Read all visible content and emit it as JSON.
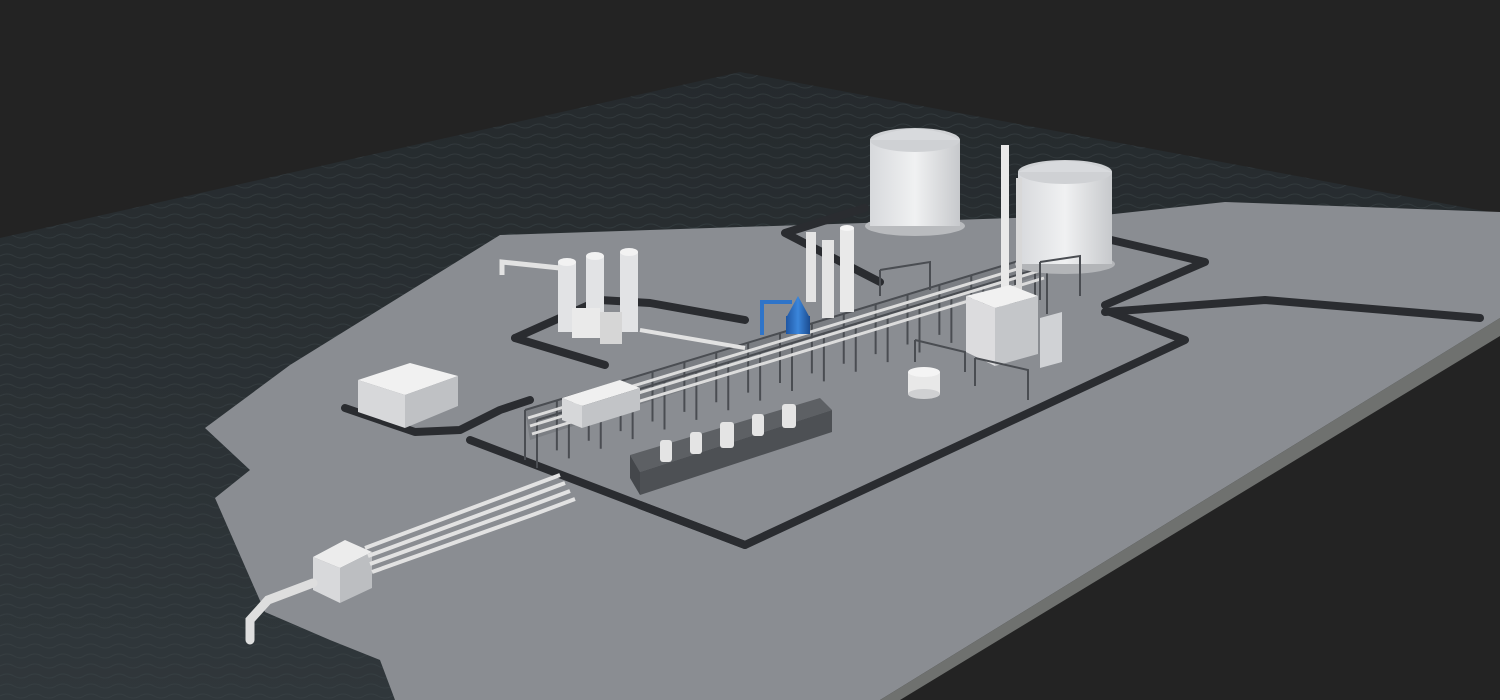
{
  "scene": {
    "description_visible_text": "",
    "colors": {
      "background": "#232323",
      "sea": "#2b3033",
      "ground": "#8a8d92",
      "road": "#2a2c30",
      "equipment": "#e6e6e6",
      "highlight_vessel": "#2f74c8",
      "platform_side": "#6f716f"
    },
    "objects": [
      {
        "name": "storage-tank",
        "count": 2
      },
      {
        "name": "flare-stack",
        "count": 2
      },
      {
        "name": "process-column",
        "count": 5
      },
      {
        "name": "pipe-rack",
        "count": 1
      },
      {
        "name": "warehouse-building",
        "count": 1
      },
      {
        "name": "control-building",
        "count": 2
      },
      {
        "name": "intake-structure",
        "count": 1
      },
      {
        "name": "blue-highlighted-vessel",
        "count": 1
      }
    ]
  }
}
